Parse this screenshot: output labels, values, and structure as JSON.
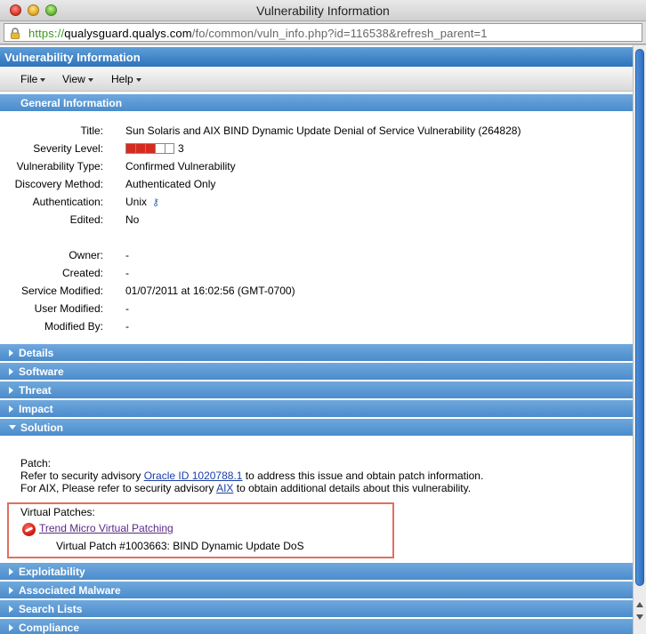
{
  "window": {
    "title": "Vulnerability Information"
  },
  "address_bar": {
    "scheme": "https://",
    "domain": "qualysguard.qualys.com",
    "path": "/fo/common/vuln_info.php?id=116538&refresh_parent=1"
  },
  "page": {
    "header": "Vulnerability Information",
    "menus": [
      {
        "label": "File"
      },
      {
        "label": "View"
      },
      {
        "label": "Help"
      }
    ],
    "general_section": "General Information",
    "fields": {
      "title": {
        "label": "Title:",
        "value": "Sun Solaris and AIX BIND Dynamic Update Denial of Service Vulnerability (264828)"
      },
      "severity": {
        "label": "Severity Level:",
        "value": "3",
        "level": 3,
        "max": 5
      },
      "vuln_type": {
        "label": "Vulnerability Type:",
        "value": "Confirmed Vulnerability"
      },
      "discovery": {
        "label": "Discovery Method:",
        "value": "Authenticated Only"
      },
      "authentication": {
        "label": "Authentication:",
        "value": "Unix",
        "icon": "key-icon"
      },
      "edited": {
        "label": "Edited:",
        "value": "No"
      },
      "owner": {
        "label": "Owner:",
        "value": "-"
      },
      "created": {
        "label": "Created:",
        "value": "-"
      },
      "service_modified": {
        "label": "Service Modified:",
        "value": "01/07/2011 at 16:02:56 (GMT-0700)"
      },
      "user_modified": {
        "label": "User Modified:",
        "value": "-"
      },
      "modified_by": {
        "label": "Modified By:",
        "value": "-"
      }
    },
    "collapsed_sections_top": [
      "Details",
      "Software",
      "Threat",
      "Impact"
    ],
    "solution": {
      "label": "Solution",
      "patch_label": "Patch:",
      "line1_pre": "Refer to security advisory ",
      "line1_link": "Oracle ID 1020788.1",
      "line1_post": " to address this issue and obtain patch information.",
      "line2_pre": "For AIX, Please refer to security advisory ",
      "line2_link": "AIX",
      "line2_post": " to obtain additional details about this vulnerability.",
      "virtual_patches_label": "Virtual Patches:",
      "trend_link": "Trend Micro Virtual Patching",
      "virtual_patch": "Virtual Patch #1003663: BIND Dynamic Update DoS"
    },
    "collapsed_sections_bottom": [
      "Exploitability",
      "Associated Malware",
      "Search Lists",
      "Compliance"
    ]
  },
  "colors": {
    "header_blue": "#2e73bb",
    "section_blue": "#4b8ccc",
    "severity_red": "#d72a1e",
    "highlight_box": "#e0705f"
  }
}
